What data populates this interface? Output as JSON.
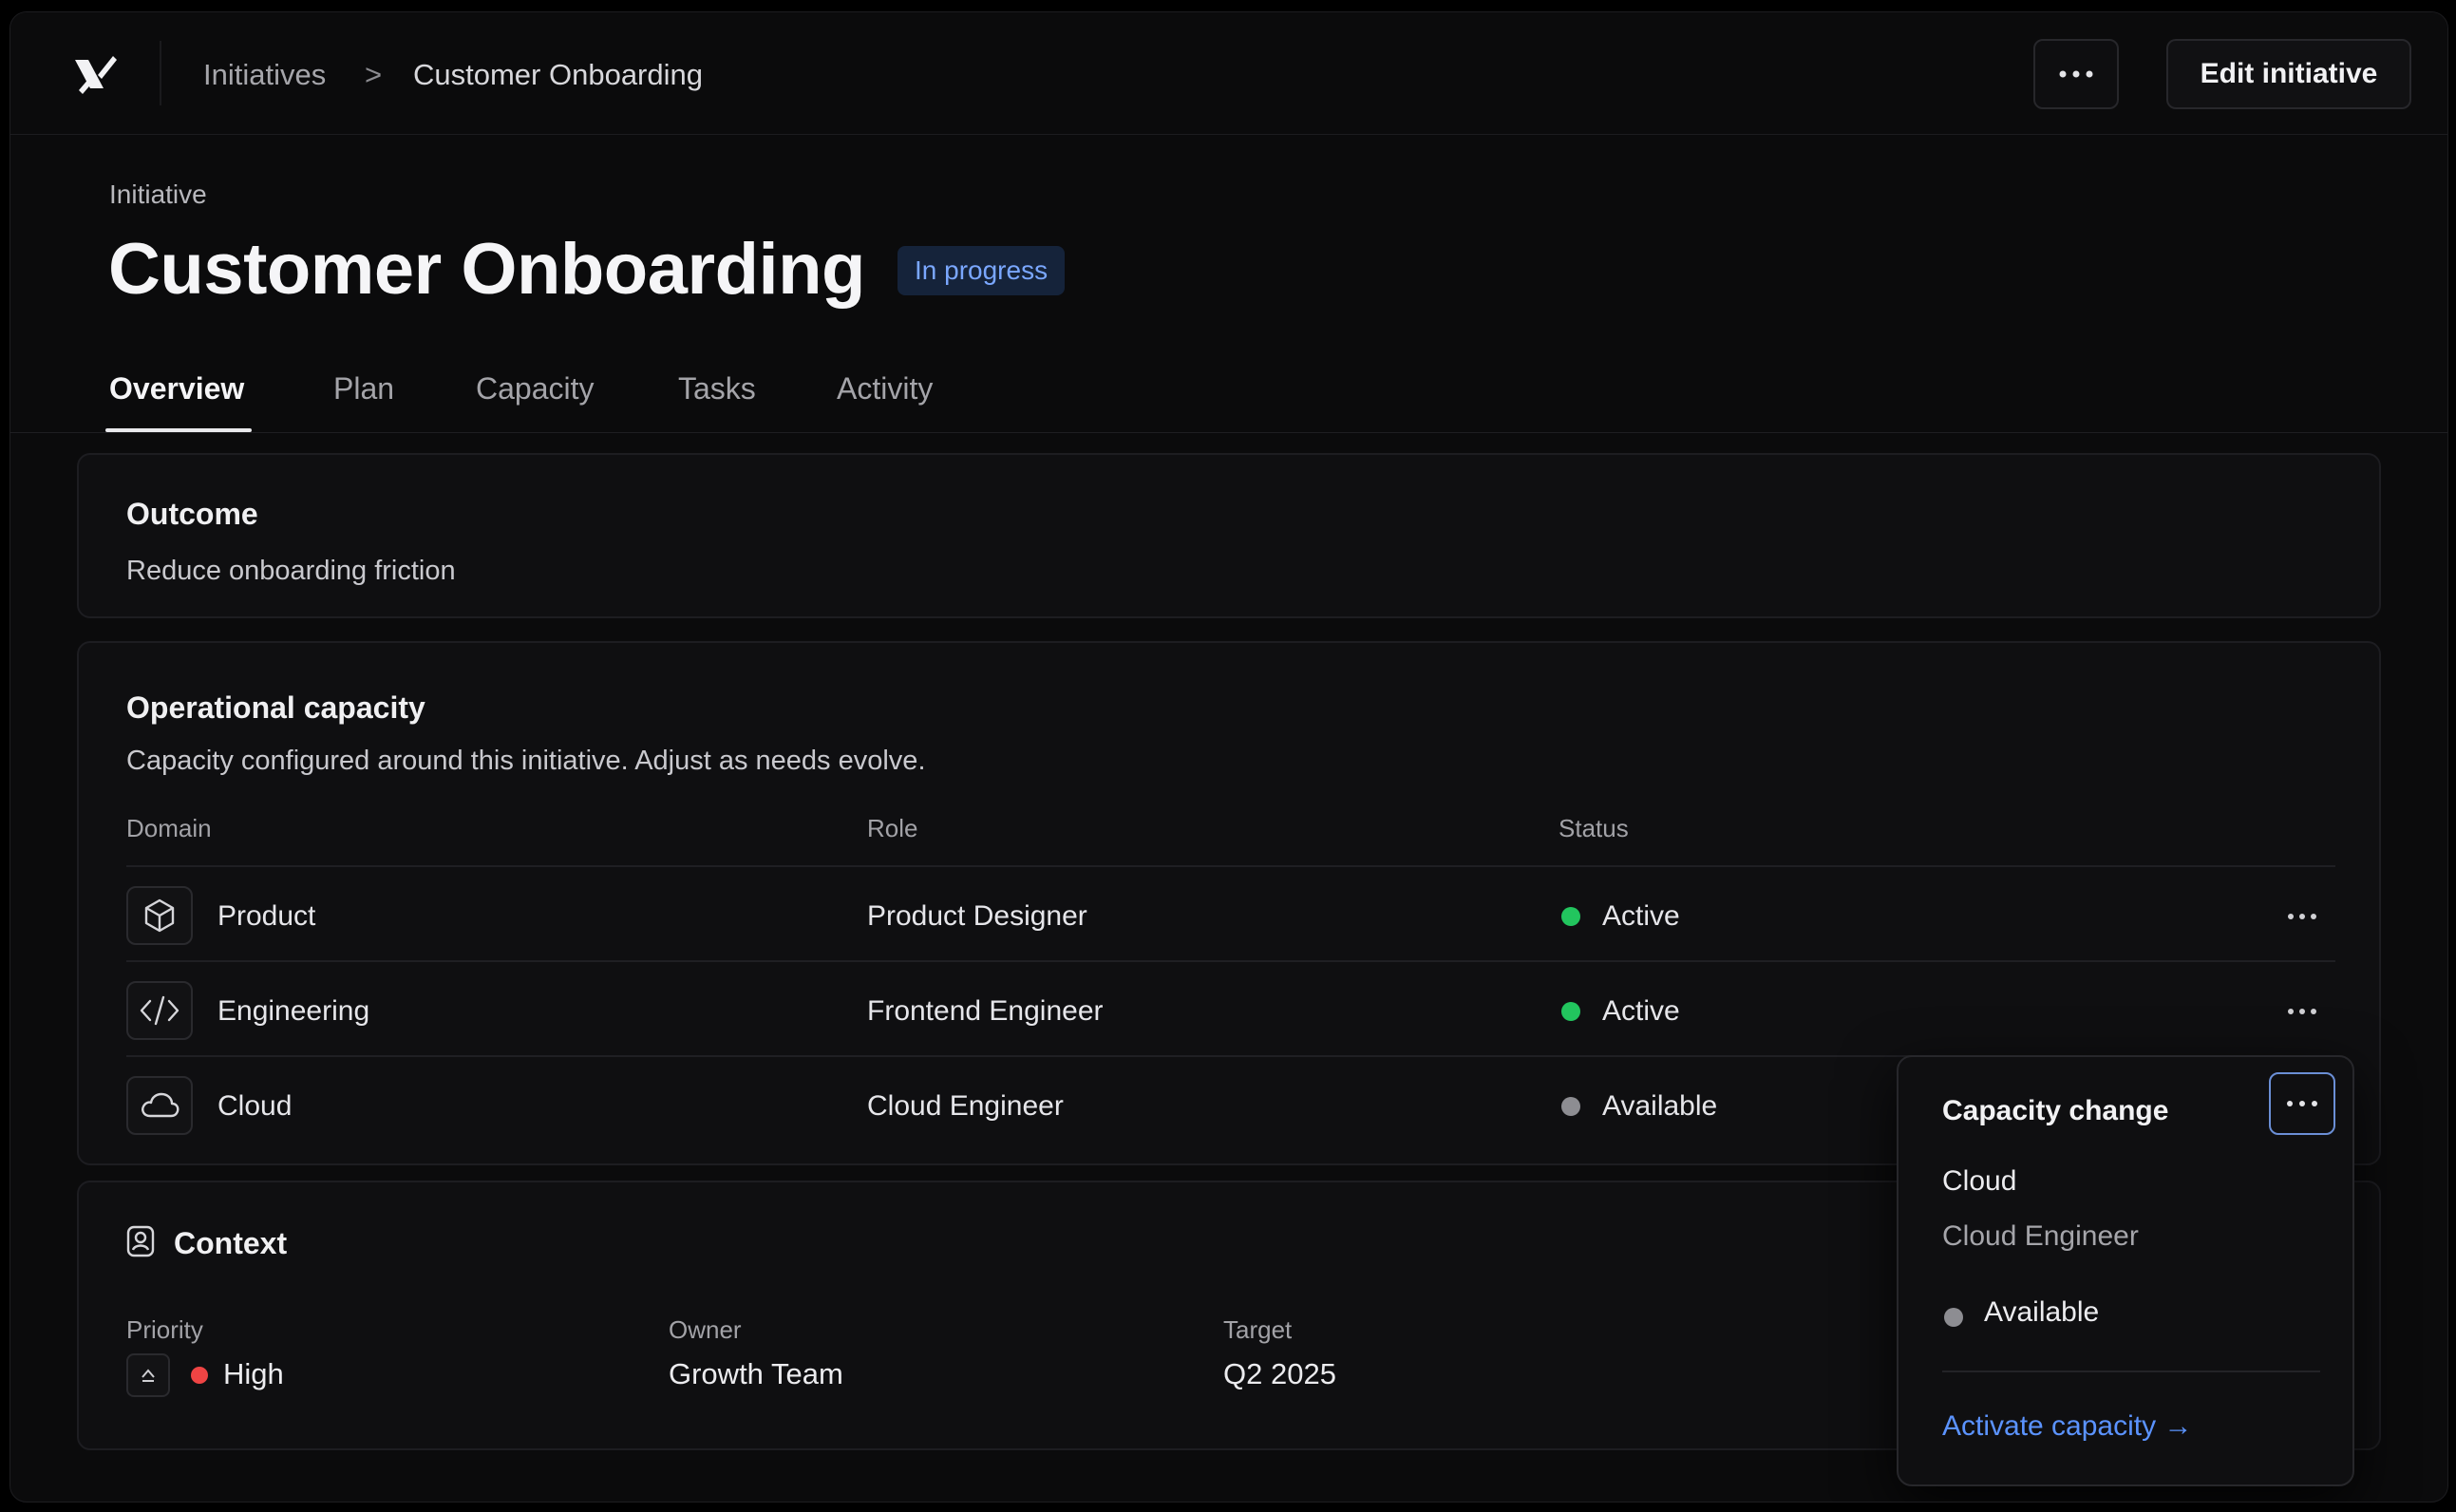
{
  "breadcrumb": {
    "parent": "Initiatives",
    "separator": ">",
    "current": "Customer Onboarding"
  },
  "actions": {
    "edit_label": "Edit initiative"
  },
  "header": {
    "eyebrow": "Initiative",
    "title": "Customer Onboarding",
    "status_badge": "In progress"
  },
  "tabs": [
    {
      "label": "Overview",
      "active": true
    },
    {
      "label": "Plan"
    },
    {
      "label": "Capacity"
    },
    {
      "label": "Tasks"
    },
    {
      "label": "Activity"
    }
  ],
  "outcome": {
    "title": "Outcome",
    "text": "Reduce onboarding friction"
  },
  "capacity": {
    "title": "Operational capacity",
    "description": "Capacity configured around this initiative. Adjust as needs evolve.",
    "columns": {
      "domain": "Domain",
      "role": "Role",
      "status": "Status"
    },
    "rows": [
      {
        "domain": "Product",
        "icon": "cube-icon",
        "role": "Product Designer",
        "status": "Active",
        "status_color": "#22c55e"
      },
      {
        "domain": "Engineering",
        "icon": "code-icon",
        "role": "Frontend Engineer",
        "status": "Active",
        "status_color": "#22c55e"
      },
      {
        "domain": "Cloud",
        "icon": "cloud-icon",
        "role": "Cloud Engineer",
        "status": "Available",
        "status_color": "#8d8d92"
      }
    ]
  },
  "popover": {
    "title": "Capacity change",
    "domain": "Cloud",
    "role": "Cloud Engineer",
    "status": "Available",
    "link": "Activate capacity →"
  },
  "context": {
    "title": "Context",
    "priority": {
      "label": "Priority",
      "value": "High",
      "color": "#ef4444"
    },
    "owner": {
      "label": "Owner",
      "value": "Growth Team"
    },
    "target": {
      "label": "Target",
      "value": "Q2 2025"
    }
  },
  "colors": {
    "accent": "#5b93ff",
    "badge_text": "#7aa7ff",
    "active": "#22c55e",
    "priority_high": "#ef4444"
  }
}
